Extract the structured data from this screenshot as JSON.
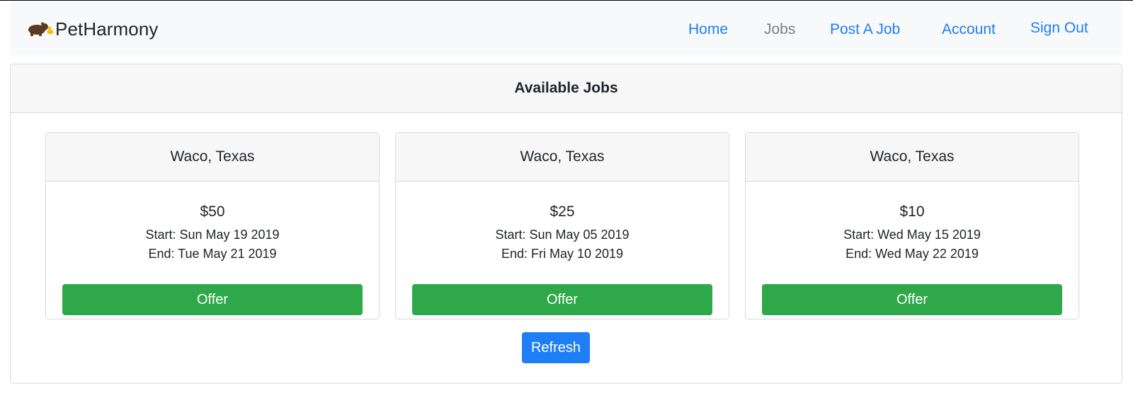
{
  "brand": {
    "name": "PetHarmony",
    "logo_icon": "bear-and-duck-icon"
  },
  "nav": {
    "home": "Home",
    "jobs": "Jobs",
    "post_job": "Post A Job",
    "account": "Account",
    "sign_out": "Sign Out"
  },
  "main": {
    "title": "Available Jobs",
    "jobs": [
      {
        "location": "Waco, Texas",
        "price": "$50",
        "start": "Start: Sun May 19 2019",
        "end": "End: Tue May 21 2019",
        "action": "Offer"
      },
      {
        "location": "Waco, Texas",
        "price": "$25",
        "start": "Start: Sun May 05 2019",
        "end": "End: Fri May 10 2019",
        "action": "Offer"
      },
      {
        "location": "Waco, Texas",
        "price": "$10",
        "start": "Start: Wed May 15 2019",
        "end": "End: Wed May 22 2019",
        "action": "Offer"
      }
    ],
    "refresh_label": "Refresh"
  },
  "colors": {
    "link": "#1e7ef4",
    "active_link": "#7a7f85",
    "success": "#2fa84a",
    "primary": "#1e7ef4",
    "navbar_bg": "#f8f9fa",
    "card_header_bg": "#f7f7f7"
  }
}
